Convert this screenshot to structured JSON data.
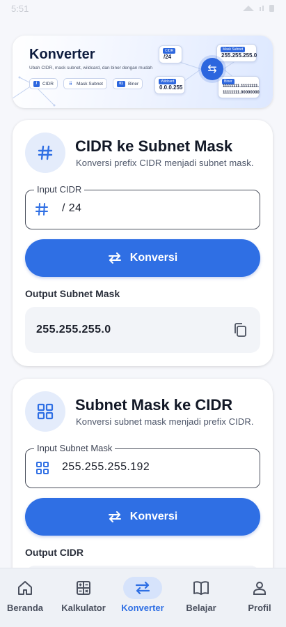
{
  "status_bar": {
    "time": "5:51"
  },
  "banner": {
    "title": "Konverter",
    "subtitle": "Ubah CIDR, mask subnet, wildcard, dan biner dengan mudah",
    "chips": [
      {
        "icon": "slash-icon",
        "label": "CIDR"
      },
      {
        "icon": "grid-icon",
        "label": "Mask Subnet"
      },
      {
        "icon": "binary-icon",
        "label": "Biner"
      }
    ],
    "cards": {
      "cidr_tag": "CIDR",
      "cidr_value": "/24",
      "mask_tag": "Mask Subnet",
      "mask_value": "255.255.255.0",
      "wildcard_tag": "Wildcard",
      "wildcard_value": "0.0.0.255",
      "binary_tag": "Biner",
      "binary_value_1": "11111111.11111111.",
      "binary_value_2": "11111111.00000000"
    }
  },
  "cidr_card": {
    "title": "CIDR ke Subnet Mask",
    "description": "Konversi prefix CIDR menjadi subnet mask.",
    "input_label": "Input CIDR",
    "input_value": "/ 24",
    "button_label": "Konversi",
    "output_label": "Output Subnet Mask",
    "output_value": "255.255.255.0"
  },
  "mask_card": {
    "title": "Subnet Mask ke CIDR",
    "description": "Konversi subnet mask menjadi prefix CIDR.",
    "input_label": "Input Subnet Mask",
    "input_value": "255.255.255.192",
    "button_label": "Konversi",
    "output_label": "Output CIDR"
  },
  "bottom_nav": {
    "items": [
      {
        "label": "Beranda",
        "icon": "home-icon"
      },
      {
        "label": "Kalkulator",
        "icon": "calculator-icon"
      },
      {
        "label": "Konverter",
        "icon": "swap-icon",
        "active": true
      },
      {
        "label": "Belajar",
        "icon": "book-icon"
      },
      {
        "label": "Profil",
        "icon": "person-icon"
      }
    ]
  },
  "colors": {
    "primary": "#2f6fe4",
    "icon_bg": "#e4ecfb",
    "active_pill": "#d6e3fb"
  }
}
